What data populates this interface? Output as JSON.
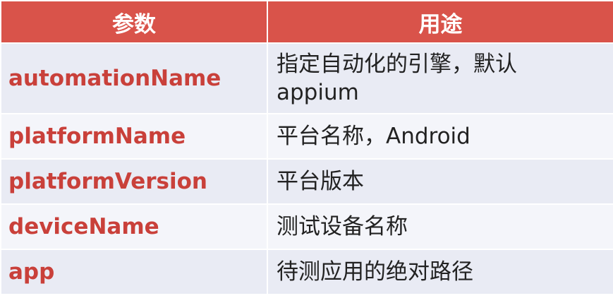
{
  "header": {
    "col_param": "参数",
    "col_use": "用途"
  },
  "rows": [
    {
      "param": "automationName",
      "use_line1": "指定自动化的引擎，默认",
      "use_line2": "appium"
    },
    {
      "param": "platformName",
      "use_line1": "平台名称，Android"
    },
    {
      "param": "platformVersion",
      "use_line1": "平台版本"
    },
    {
      "param": "deviceName",
      "use_line1": "测试设备名称"
    },
    {
      "param": "app",
      "use_line1": "待测应用的绝对路径"
    }
  ],
  "colors": {
    "header_bg": "#d9534a",
    "param_text": "#c9403a",
    "row_odd": "#e9ebf4",
    "row_even": "#f4f5fa"
  }
}
